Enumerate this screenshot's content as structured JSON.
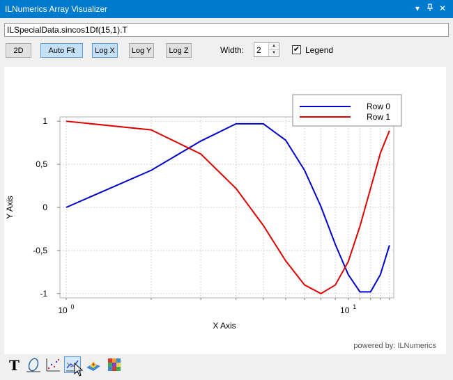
{
  "window": {
    "title": "ILNumerics Array Visualizer",
    "icons": [
      "chevron-down-icon",
      "pin-icon",
      "close-icon"
    ]
  },
  "expression": {
    "value": "ILSpecialData.sincos1Df(15,1).T"
  },
  "toolbar": {
    "btn_2d": "2D",
    "btn_autofit": "Auto Fit",
    "btn_logx": "Log X",
    "btn_logy": "Log Y",
    "btn_logz": "Log Z",
    "width_label": "Width:",
    "width_value": "2",
    "legend_label": "Legend",
    "legend_checked": true
  },
  "branding": "powered by: ILNumerics",
  "bottom_tools": [
    "text-tool-icon",
    "shape-tool-icon",
    "scatter-plot-icon",
    "line-plot-icon",
    "surface-plot-icon",
    "image-plot-icon"
  ],
  "chart_data": {
    "type": "line",
    "xlabel": "X Axis",
    "ylabel": "Y Axis",
    "xscale": "log",
    "xlim": [
      0.95,
      14.5
    ],
    "ylim": [
      -1.05,
      1.05
    ],
    "yticks": [
      "1",
      "0,5",
      "0",
      "-0,5",
      "-1"
    ],
    "ytick_values": [
      1,
      0.5,
      0,
      -0.5,
      -1
    ],
    "xticks": [
      {
        "base": "10",
        "exp": "0",
        "value": 1
      },
      {
        "base": "10",
        "exp": "1",
        "value": 10
      }
    ],
    "grid": true,
    "legend_position": "top-right",
    "x": [
      1,
      2,
      3,
      4,
      5,
      6,
      7,
      8,
      9,
      10,
      11,
      12,
      13,
      14
    ],
    "series": [
      {
        "name": "Row 0",
        "color": "#0000cc",
        "values": [
          0.0,
          0.43,
          0.77,
          0.97,
          0.97,
          0.78,
          0.43,
          0.01,
          -0.43,
          -0.78,
          -0.98,
          -0.98,
          -0.78,
          -0.44
        ]
      },
      {
        "name": "Row 1",
        "color": "#dd0000",
        "values": [
          1.0,
          0.9,
          0.62,
          0.22,
          -0.21,
          -0.62,
          -0.9,
          -1.0,
          -0.9,
          -0.63,
          -0.22,
          0.22,
          0.63,
          0.89
        ]
      }
    ]
  }
}
